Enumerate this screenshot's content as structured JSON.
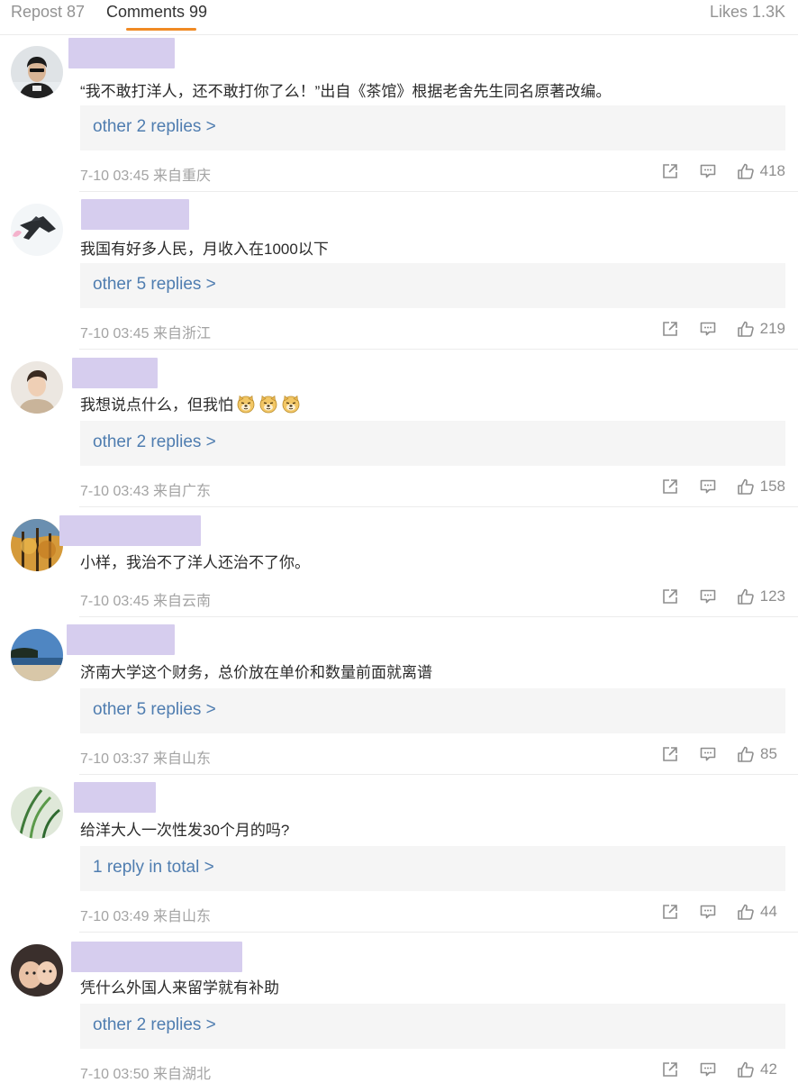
{
  "tabs": {
    "repost": "Repost 87",
    "comments": "Comments 99",
    "likes": "Likes 1.3K"
  },
  "colors": {
    "accent": "#f08a24",
    "link": "#4f7db0",
    "redacted_name": "#d6cdee"
  },
  "comments": [
    {
      "avatar": "avatar-man-dark-shirt",
      "text": "“我不敢打洋人，还不敢打你了么！”出自《茶馆》根据老舍先生同名原著改编。",
      "replies": "other 2 replies >",
      "meta": "7-10 03:45 来自重庆",
      "likes": "418"
    },
    {
      "avatar": "avatar-dark-jet",
      "text": "我国有好多人民，月收入在1000以下",
      "replies": "other 5 replies >",
      "meta": "7-10 03:45 来自浙江",
      "likes": "219"
    },
    {
      "avatar": "avatar-young-man",
      "text": "我想说点什么，但我怕",
      "emoji": [
        "doge-emoji",
        "doge-emoji",
        "doge-emoji"
      ],
      "replies": "other 2 replies >",
      "meta": "7-10 03:43 来自广东",
      "likes": "158"
    },
    {
      "avatar": "avatar-autumn-trees",
      "text": "小样，我治不了洋人还治不了你。",
      "meta": "7-10 03:45 来自云南",
      "likes": "123"
    },
    {
      "avatar": "avatar-beach-sky",
      "text": "济南大学这个财务，总价放在单价和数量前面就离谱",
      "replies": "other 5 replies >",
      "meta": "7-10 03:37 来自山东",
      "likes": "85"
    },
    {
      "avatar": "avatar-green-grass",
      "text": "给洋大人一次性发30个月的吗?",
      "replies": "1 reply in total >",
      "meta": "7-10 03:49 来自山东",
      "likes": "44"
    },
    {
      "avatar": "avatar-baby-photo",
      "text": "凭什么外国人来留学就有补助",
      "replies": "other 2 replies >",
      "meta": "7-10 03:50 来自湖北",
      "likes": "42"
    }
  ]
}
